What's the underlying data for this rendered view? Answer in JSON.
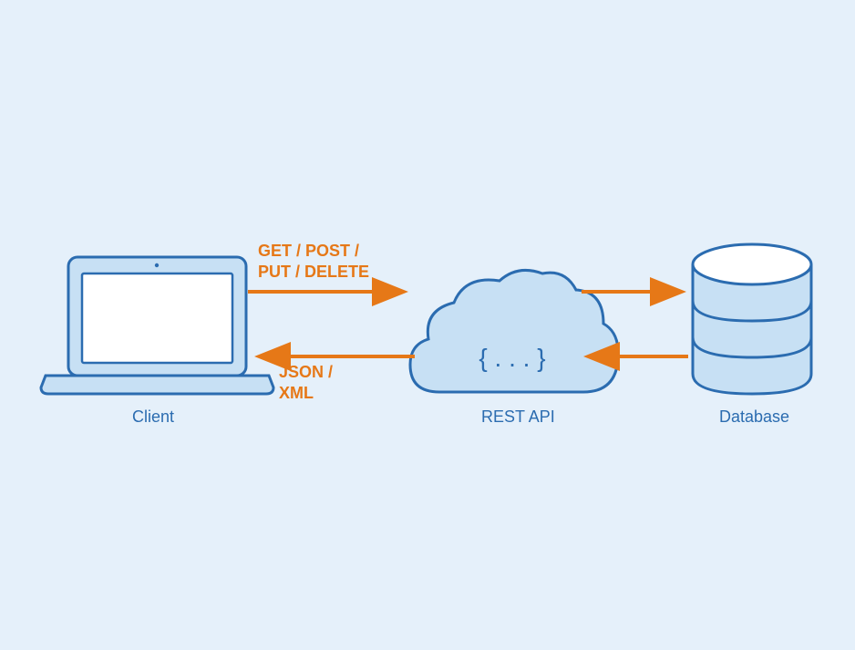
{
  "nodes": {
    "client": {
      "label": "Client"
    },
    "api": {
      "label": "REST API",
      "code": "{ . . . }"
    },
    "database": {
      "label": "Database"
    }
  },
  "arrows": {
    "request": {
      "line1": "GET / POST /",
      "line2": "PUT / DELETE"
    },
    "response": {
      "line1": "JSON /",
      "line2": "XML"
    }
  },
  "colors": {
    "blue": "#2b6cb0",
    "lightBlue": "#c7e0f4",
    "orange": "#e67817",
    "bg": "#e5f0fa",
    "white": "#ffffff"
  }
}
